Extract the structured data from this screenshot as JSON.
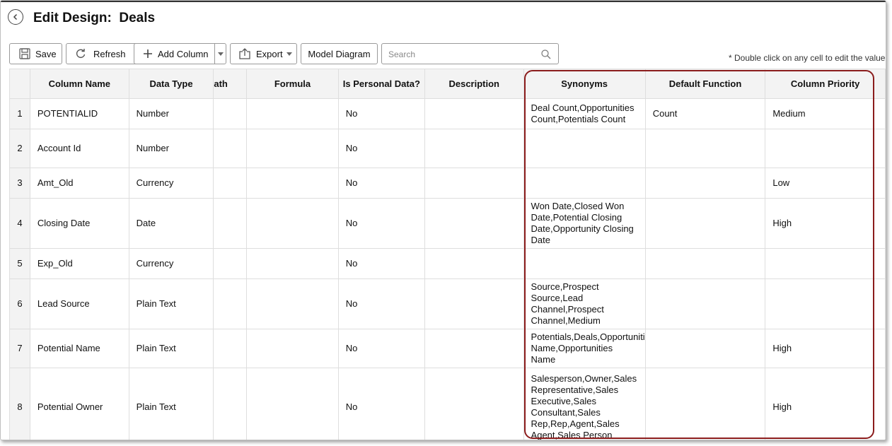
{
  "header": {
    "title": "Edit Design:  Deals"
  },
  "toolbar": {
    "save_label": "Save",
    "refresh_label": "Refresh",
    "add_column_label": "Add Column",
    "export_label": "Export",
    "model_diagram_label": "Model Diagram",
    "search_placeholder": "Search",
    "hint": "* Double click on any cell to edit the value"
  },
  "table": {
    "columns": [
      "Column Name",
      "Data Type",
      "Path",
      "Formula",
      "Is Personal Data?",
      "Description",
      "Synonyms",
      "Default Function",
      "Column Priority"
    ],
    "path_header_visible": "ath",
    "rows": [
      {
        "num": "1",
        "name": "POTENTIALID",
        "type": "Number",
        "personal": "No",
        "synonyms": "Deal Count,Opportunities\nCount,Potentials Count",
        "default_function": "Count",
        "priority": "Medium"
      },
      {
        "num": "2",
        "name": "Account Id",
        "type": "Number",
        "personal": "No",
        "synonyms": "",
        "default_function": "",
        "priority": ""
      },
      {
        "num": "3",
        "name": "Amt_Old",
        "type": "Currency",
        "personal": "No",
        "synonyms": "",
        "default_function": "",
        "priority": "Low"
      },
      {
        "num": "4",
        "name": "Closing Date",
        "type": "Date",
        "personal": "No",
        "synonyms": "Won Date,Closed Won\nDate,Potential Closing\nDate,Opportunity Closing\nDate",
        "default_function": "",
        "priority": "High"
      },
      {
        "num": "5",
        "name": "Exp_Old",
        "type": "Currency",
        "personal": "No",
        "synonyms": "",
        "default_function": "",
        "priority": ""
      },
      {
        "num": "6",
        "name": "Lead Source",
        "type": "Plain Text",
        "personal": "No",
        "synonyms": "Source,Prospect\nSource,Lead\nChannel,Prospect\nChannel,Medium",
        "default_function": "",
        "priority": ""
      },
      {
        "num": "7",
        "name": "Potential Name",
        "type": "Plain Text",
        "personal": "No",
        "synonyms": "Potentials,Deals,Opportuniti\nName,Opportunities\nName",
        "default_function": "",
        "priority": "High"
      },
      {
        "num": "8",
        "name": "Potential Owner",
        "type": "Plain Text",
        "personal": "No",
        "synonyms": "Salesperson,Owner,Sales\nRepresentative,Sales\nExecutive,Sales\nConsultant,Sales\nRep,Rep,Agent,Sales\nAgent,Sales Person",
        "default_function": "",
        "priority": "High"
      }
    ]
  },
  "colors": {
    "highlight": "#8b1c1c",
    "header_bg": "#f3f3f3",
    "grid_line": "#dedede"
  },
  "icons": {
    "back": "back-arrow-icon",
    "save": "floppy-disk-icon",
    "refresh": "refresh-icon",
    "add": "plus-icon",
    "export": "export-icon",
    "search": "search-icon"
  }
}
